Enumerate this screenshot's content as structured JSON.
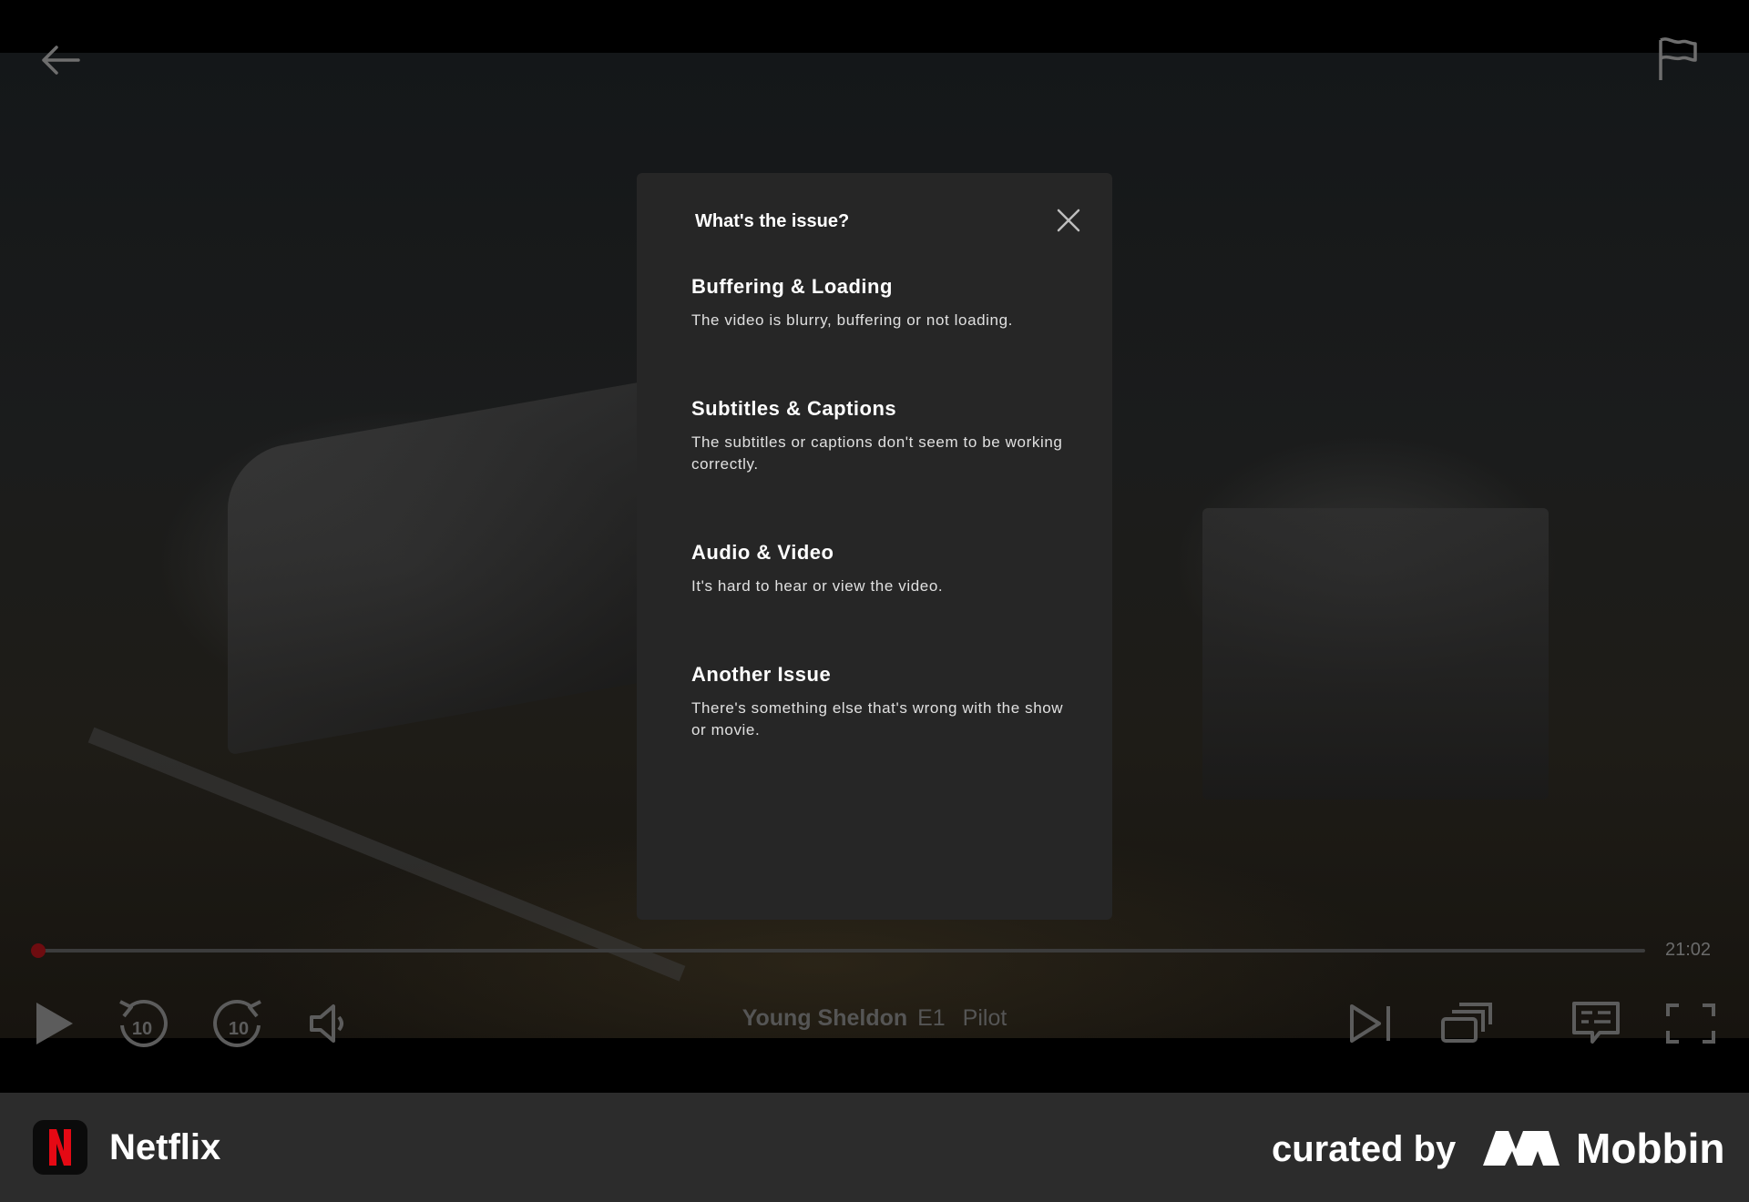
{
  "player": {
    "back_icon": "arrow-left-icon",
    "report_icon": "flag-icon",
    "time_remaining": "21:02",
    "progress_fraction": 0.006,
    "episode": {
      "show": "Young Sheldon",
      "episode_number": "E1",
      "episode_title": "Pilot"
    },
    "controls": {
      "play_icon": "play-icon",
      "rewind_icon": "rewind-10-icon",
      "rewind_label": "10",
      "forward_icon": "forward-10-icon",
      "forward_label": "10",
      "volume_icon": "volume-icon",
      "next_icon": "next-episode-icon",
      "episodes_icon": "episodes-icon",
      "subtitles_icon": "subtitles-icon",
      "fullscreen_icon": "fullscreen-icon"
    }
  },
  "modal": {
    "title": "What's the issue?",
    "close_icon": "close-icon",
    "issues": [
      {
        "title": "Buffering & Loading",
        "description": "The video is blurry, buffering or not loading."
      },
      {
        "title": "Subtitles & Captions",
        "description": "The subtitles or captions don't seem to be working correctly."
      },
      {
        "title": "Audio & Video",
        "description": "It's hard to hear or view the video."
      },
      {
        "title": "Another Issue",
        "description": "There's something else that's wrong with the show or movie."
      }
    ]
  },
  "footer": {
    "app_name": "Netflix",
    "app_logo_letter": "N",
    "curated_by": "curated by",
    "brand_name": "Mobbin"
  },
  "colors": {
    "accent_red": "#E50914",
    "modal_bg": "#262626",
    "footer_bg": "#2C2C2C"
  }
}
